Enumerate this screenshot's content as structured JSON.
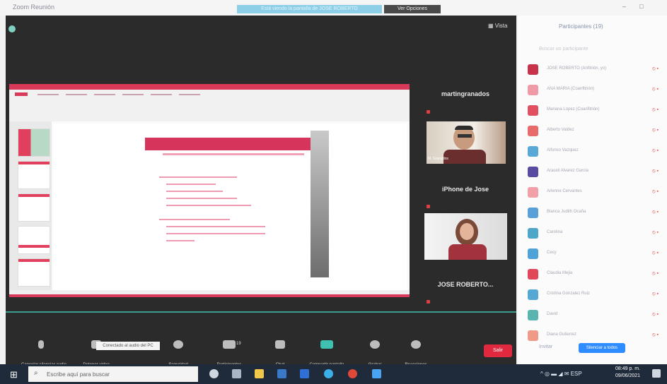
{
  "app": {
    "title": "Zoom Reunión"
  },
  "share_banner": {
    "text": "Está viendo la pantalla de JOSE ROBERTO",
    "stop_label": "Ver Opciones"
  },
  "view_button": "Vista",
  "tiles": [
    {
      "name": "martingranados",
      "video_label": "M. Granados"
    },
    {
      "name": "iPhone de Jose"
    },
    {
      "name": "JOSE ROBERTO..."
    }
  ],
  "toolbar": {
    "items": [
      {
        "key": "audio",
        "label": "Cancelar silenciar audio"
      },
      {
        "key": "video",
        "label": "Detener video"
      },
      {
        "key": "security",
        "label": "Seguridad"
      },
      {
        "key": "participants",
        "label": "Participantes",
        "count": "19"
      },
      {
        "key": "chat",
        "label": "Chat"
      },
      {
        "key": "share",
        "label": "Compartir pantalla"
      },
      {
        "key": "record",
        "label": "Grabar"
      },
      {
        "key": "reactions",
        "label": "Reacciones"
      }
    ],
    "tooltip": "Conectado al audio del PC",
    "end_label": "Salir"
  },
  "panel": {
    "title": "Participantes (19)",
    "search_placeholder": "Buscar un participante",
    "participants": [
      {
        "name": "JOSE ROBERTO (Anfitrión, yo)",
        "color": "#c8334c"
      },
      {
        "name": "ANA MARIA (Coanfitrión)",
        "color": "#ef9aa6"
      },
      {
        "name": "Mariana Lopez (Coanfitrión)",
        "color": "#e05060"
      },
      {
        "name": "Alberto Valdez",
        "color": "#e86a6a"
      },
      {
        "name": "Alfonso Vazquez",
        "color": "#59a9d8"
      },
      {
        "name": "Araceli Alvarez Garcia",
        "color": "#5a4aa0"
      },
      {
        "name": "Arlenne Cervantes",
        "color": "#f0a0a6"
      },
      {
        "name": "Blanca Judith Ocaña",
        "color": "#5aa0d8"
      },
      {
        "name": "Carolina",
        "color": "#4ea7c8"
      },
      {
        "name": "Cecy",
        "color": "#4fa3d6"
      },
      {
        "name": "Claudia Mejia",
        "color": "#e0485a"
      },
      {
        "name": "Cristina Gonzalez Ruiz",
        "color": "#55a8d4"
      },
      {
        "name": "David",
        "color": "#5ab5b0"
      },
      {
        "name": "Diana Gutierrez",
        "color": "#ef9a86"
      }
    ],
    "invite_label": "Invitar",
    "mute_all_label": "Silenciar a todos"
  },
  "taskbar": {
    "search_placeholder": "Escribe aquí para buscar",
    "time": "08:49 p. m.",
    "date": "09/06/2021"
  }
}
